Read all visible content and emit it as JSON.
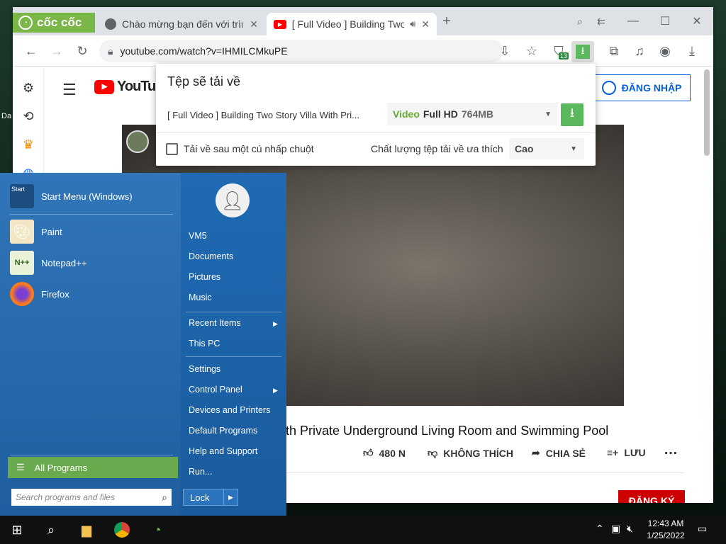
{
  "desktop": {
    "icon_label": "Da"
  },
  "browser": {
    "brand": "cốc cốc",
    "tabs": [
      {
        "title": "Chào mừng bạn đến với trình",
        "close": "✕"
      },
      {
        "title": "[ Full Video ] Building Two Story",
        "close": "✕"
      }
    ],
    "new_tab": "+",
    "window": {
      "minimize": "—",
      "maximize": "☐",
      "close": "✕"
    },
    "url": "youtube.com/watch?v=IHMILCMkuPE",
    "extension_badge": "13"
  },
  "youtube": {
    "logo_text": "YouTube",
    "signin_label": "ĐĂNG NHẬP",
    "video_title": "th Private Underground Living Room and Swimming Pool",
    "like_label": "480 N",
    "dislike_label": "KHÔNG THÍCH",
    "share_label": "CHIA SẺ",
    "save_label": "LƯU",
    "more": "…",
    "subscribe_label": "ĐĂNG KÝ"
  },
  "download_popup": {
    "title": "Tệp sẽ tải về",
    "file_name": "[ Full Video ] Building Two Story Villa With Pri...",
    "quality": {
      "type": "Video",
      "resolution": "Full HD",
      "size": "764MB"
    },
    "one_click_label": "Tải về sau một cú nhấp chuột",
    "pref_label": "Chất lượng tệp tải về ưa thích",
    "pref_value": "Cao"
  },
  "start_menu": {
    "pinned": [
      {
        "label": "Start Menu (Windows)",
        "icon_text": "Start"
      },
      {
        "label": "Paint"
      },
      {
        "label": "Notepad++"
      },
      {
        "label": "Firefox"
      }
    ],
    "all_programs": "All Programs",
    "search_placeholder": "Search programs and files",
    "right": {
      "user": "VM5",
      "documents": "Documents",
      "pictures": "Pictures",
      "music": "Music",
      "recent": "Recent Items",
      "this_pc": "This PC",
      "settings": "Settings",
      "control_panel": "Control Panel",
      "devices": "Devices and Printers",
      "default_programs": "Default Programs",
      "help": "Help and Support",
      "run": "Run..."
    },
    "lock": "Lock"
  },
  "taskbar": {
    "time": "12:43 AM",
    "date": "1/25/2022"
  }
}
